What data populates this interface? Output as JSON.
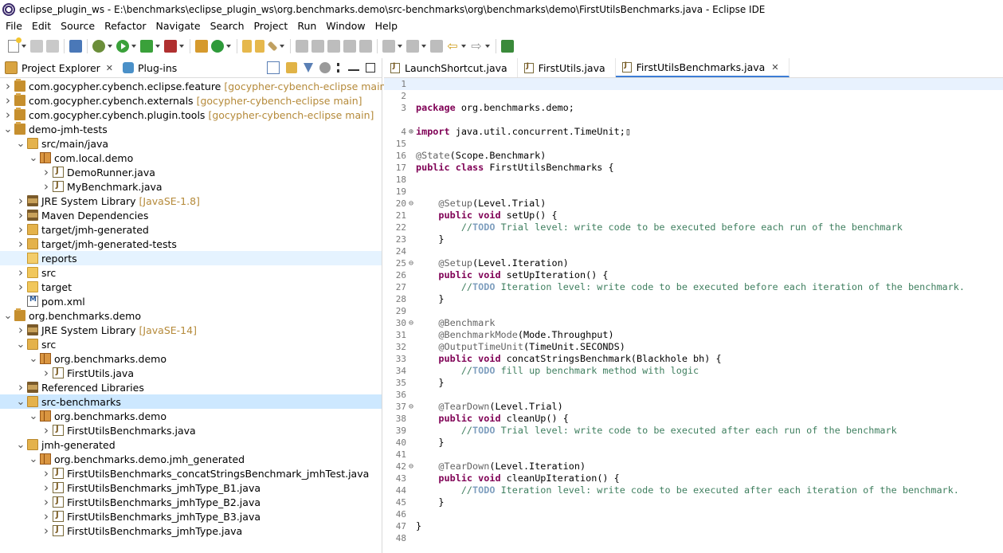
{
  "window": {
    "title": "eclipse_plugin_ws - E:\\benchmarks\\eclipse_plugin_ws\\org.benchmarks.demo\\src-benchmarks\\org\\benchmarks\\demo\\FirstUtilsBenchmarks.java - Eclipse IDE"
  },
  "menu": [
    "File",
    "Edit",
    "Source",
    "Refactor",
    "Navigate",
    "Search",
    "Project",
    "Run",
    "Window",
    "Help"
  ],
  "left_tabs": [
    {
      "label": "Project Explorer",
      "active": true,
      "closable": true
    },
    {
      "label": "Plug-ins",
      "active": false,
      "closable": false
    }
  ],
  "tree": [
    {
      "indent": 0,
      "twisty": ">",
      "icon": "project",
      "label": "com.gocypher.cybench.eclipse.feature",
      "decor": "[gocypher-cybench-eclipse main]"
    },
    {
      "indent": 0,
      "twisty": ">",
      "icon": "project",
      "label": "com.gocypher.cybench.externals",
      "decor": "[gocypher-cybench-eclipse main]"
    },
    {
      "indent": 0,
      "twisty": ">",
      "icon": "project",
      "label": "com.gocypher.cybench.plugin.tools",
      "decor": "[gocypher-cybench-eclipse main]"
    },
    {
      "indent": 0,
      "twisty": "v",
      "icon": "project",
      "label": "demo-jmh-tests",
      "decor": ""
    },
    {
      "indent": 1,
      "twisty": "v",
      "icon": "srcfolder",
      "label": "src/main/java",
      "decor": ""
    },
    {
      "indent": 2,
      "twisty": "v",
      "icon": "package",
      "label": "com.local.demo",
      "decor": ""
    },
    {
      "indent": 3,
      "twisty": ">",
      "icon": "java",
      "label": "DemoRunner.java",
      "decor": ""
    },
    {
      "indent": 3,
      "twisty": ">",
      "icon": "java",
      "label": "MyBenchmark.java",
      "decor": ""
    },
    {
      "indent": 1,
      "twisty": ">",
      "icon": "library",
      "label": "JRE System Library",
      "decor": "[JavaSE-1.8]"
    },
    {
      "indent": 1,
      "twisty": ">",
      "icon": "library",
      "label": "Maven Dependencies",
      "decor": ""
    },
    {
      "indent": 1,
      "twisty": ">",
      "icon": "srcfolder",
      "label": "target/jmh-generated",
      "decor": ""
    },
    {
      "indent": 1,
      "twisty": ">",
      "icon": "srcfolder",
      "label": "target/jmh-generated-tests",
      "decor": ""
    },
    {
      "indent": 1,
      "twisty": "",
      "icon": "reports",
      "label": "reports",
      "decor": "",
      "highlighted": true
    },
    {
      "indent": 1,
      "twisty": ">",
      "icon": "folder",
      "label": "src",
      "decor": ""
    },
    {
      "indent": 1,
      "twisty": ">",
      "icon": "folder",
      "label": "target",
      "decor": ""
    },
    {
      "indent": 1,
      "twisty": "",
      "icon": "xml",
      "label": "pom.xml",
      "decor": ""
    },
    {
      "indent": 0,
      "twisty": "v",
      "icon": "project",
      "label": "org.benchmarks.demo",
      "decor": ""
    },
    {
      "indent": 1,
      "twisty": ">",
      "icon": "library",
      "label": "JRE System Library",
      "decor": "[JavaSE-14]"
    },
    {
      "indent": 1,
      "twisty": "v",
      "icon": "srcfolder",
      "label": "src",
      "decor": ""
    },
    {
      "indent": 2,
      "twisty": "v",
      "icon": "package",
      "label": "org.benchmarks.demo",
      "decor": ""
    },
    {
      "indent": 3,
      "twisty": ">",
      "icon": "java",
      "label": "FirstUtils.java",
      "decor": ""
    },
    {
      "indent": 1,
      "twisty": ">",
      "icon": "library",
      "label": "Referenced Libraries",
      "decor": ""
    },
    {
      "indent": 1,
      "twisty": "v",
      "icon": "srcfolder",
      "label": "src-benchmarks",
      "decor": "",
      "selected": true
    },
    {
      "indent": 2,
      "twisty": "v",
      "icon": "package",
      "label": "org.benchmarks.demo",
      "decor": ""
    },
    {
      "indent": 3,
      "twisty": ">",
      "icon": "java",
      "label": "FirstUtilsBenchmarks.java",
      "decor": ""
    },
    {
      "indent": 1,
      "twisty": "v",
      "icon": "srcfolder",
      "label": "jmh-generated",
      "decor": ""
    },
    {
      "indent": 2,
      "twisty": "v",
      "icon": "package",
      "label": "org.benchmarks.demo.jmh_generated",
      "decor": ""
    },
    {
      "indent": 3,
      "twisty": ">",
      "icon": "java",
      "label": "FirstUtilsBenchmarks_concatStringsBenchmark_jmhTest.java",
      "decor": ""
    },
    {
      "indent": 3,
      "twisty": ">",
      "icon": "java",
      "label": "FirstUtilsBenchmarks_jmhType_B1.java",
      "decor": ""
    },
    {
      "indent": 3,
      "twisty": ">",
      "icon": "java",
      "label": "FirstUtilsBenchmarks_jmhType_B2.java",
      "decor": ""
    },
    {
      "indent": 3,
      "twisty": ">",
      "icon": "java",
      "label": "FirstUtilsBenchmarks_jmhType_B3.java",
      "decor": ""
    },
    {
      "indent": 3,
      "twisty": ">",
      "icon": "java",
      "label": "FirstUtilsBenchmarks_jmhType.java",
      "decor": ""
    }
  ],
  "editor_tabs": [
    {
      "label": "LaunchShortcut.java",
      "active": false
    },
    {
      "label": "FirstUtils.java",
      "active": false
    },
    {
      "label": "FirstUtilsBenchmarks.java",
      "active": true
    }
  ],
  "code": [
    {
      "n": "1",
      "fold": "",
      "current": true,
      "parts": []
    },
    {
      "n": "2",
      "fold": "",
      "parts": []
    },
    {
      "n": "3",
      "fold": "",
      "parts": [
        [
          "kw",
          "package"
        ],
        [
          "t",
          " org.benchmarks.demo;"
        ]
      ]
    },
    {
      "n": "",
      "fold": "",
      "parts": []
    },
    {
      "n": "4",
      "fold": "+",
      "parts": [
        [
          "kw",
          "import"
        ],
        [
          "t",
          " java.util.concurrent.TimeUnit;"
        ],
        [
          "t",
          "▯"
        ]
      ]
    },
    {
      "n": "15",
      "fold": "",
      "parts": []
    },
    {
      "n": "16",
      "fold": "",
      "parts": [
        [
          "ann",
          "@State"
        ],
        [
          "t",
          "(Scope.Benchmark)"
        ]
      ]
    },
    {
      "n": "17",
      "fold": "",
      "parts": [
        [
          "kw",
          "public"
        ],
        [
          "t",
          " "
        ],
        [
          "kw",
          "class"
        ],
        [
          "t",
          " FirstUtilsBenchmarks {"
        ]
      ]
    },
    {
      "n": "18",
      "fold": "",
      "parts": []
    },
    {
      "n": "19",
      "fold": "",
      "parts": []
    },
    {
      "n": "20",
      "fold": "-",
      "parts": [
        [
          "t",
          "    "
        ],
        [
          "ann",
          "@Setup"
        ],
        [
          "t",
          "(Level.Trial)"
        ]
      ]
    },
    {
      "n": "21",
      "fold": "",
      "parts": [
        [
          "t",
          "    "
        ],
        [
          "kw",
          "public"
        ],
        [
          "t",
          " "
        ],
        [
          "kw",
          "void"
        ],
        [
          "t",
          " setUp() {"
        ]
      ]
    },
    {
      "n": "22",
      "fold": "",
      "parts": [
        [
          "t",
          "        "
        ],
        [
          "cmt",
          "//"
        ],
        [
          "todo",
          "TODO"
        ],
        [
          "cmt",
          " Trial level: write code to be executed before each run of the benchmark"
        ]
      ]
    },
    {
      "n": "23",
      "fold": "",
      "parts": [
        [
          "t",
          "    }"
        ]
      ]
    },
    {
      "n": "24",
      "fold": "",
      "parts": []
    },
    {
      "n": "25",
      "fold": "-",
      "parts": [
        [
          "t",
          "    "
        ],
        [
          "ann",
          "@Setup"
        ],
        [
          "t",
          "(Level.Iteration)"
        ]
      ]
    },
    {
      "n": "26",
      "fold": "",
      "parts": [
        [
          "t",
          "    "
        ],
        [
          "kw",
          "public"
        ],
        [
          "t",
          " "
        ],
        [
          "kw",
          "void"
        ],
        [
          "t",
          " setUpIteration() {"
        ]
      ]
    },
    {
      "n": "27",
      "fold": "",
      "parts": [
        [
          "t",
          "        "
        ],
        [
          "cmt",
          "//"
        ],
        [
          "todo",
          "TODO"
        ],
        [
          "cmt",
          " Iteration level: write code to be executed before each iteration of the benchmark."
        ]
      ]
    },
    {
      "n": "28",
      "fold": "",
      "parts": [
        [
          "t",
          "    }"
        ]
      ]
    },
    {
      "n": "29",
      "fold": "",
      "parts": []
    },
    {
      "n": "30",
      "fold": "-",
      "parts": [
        [
          "t",
          "    "
        ],
        [
          "ann",
          "@Benchmark"
        ]
      ]
    },
    {
      "n": "31",
      "fold": "",
      "parts": [
        [
          "t",
          "    "
        ],
        [
          "ann",
          "@BenchmarkMode"
        ],
        [
          "t",
          "(Mode.Throughput)"
        ]
      ]
    },
    {
      "n": "32",
      "fold": "",
      "parts": [
        [
          "t",
          "    "
        ],
        [
          "ann",
          "@OutputTimeUnit"
        ],
        [
          "t",
          "(TimeUnit.SECONDS)"
        ]
      ]
    },
    {
      "n": "33",
      "fold": "",
      "parts": [
        [
          "t",
          "    "
        ],
        [
          "kw",
          "public"
        ],
        [
          "t",
          " "
        ],
        [
          "kw",
          "void"
        ],
        [
          "t",
          " concatStringsBenchmark(Blackhole bh) {"
        ]
      ]
    },
    {
      "n": "34",
      "fold": "",
      "parts": [
        [
          "t",
          "        "
        ],
        [
          "cmt",
          "//"
        ],
        [
          "todo",
          "TODO"
        ],
        [
          "cmt",
          " fill up benchmark method with logic"
        ]
      ]
    },
    {
      "n": "35",
      "fold": "",
      "parts": [
        [
          "t",
          "    }"
        ]
      ]
    },
    {
      "n": "36",
      "fold": "",
      "parts": []
    },
    {
      "n": "37",
      "fold": "-",
      "parts": [
        [
          "t",
          "    "
        ],
        [
          "ann",
          "@TearDown"
        ],
        [
          "t",
          "(Level.Trial)"
        ]
      ]
    },
    {
      "n": "38",
      "fold": "",
      "parts": [
        [
          "t",
          "    "
        ],
        [
          "kw",
          "public"
        ],
        [
          "t",
          " "
        ],
        [
          "kw",
          "void"
        ],
        [
          "t",
          " cleanUp() {"
        ]
      ]
    },
    {
      "n": "39",
      "fold": "",
      "parts": [
        [
          "t",
          "        "
        ],
        [
          "cmt",
          "//"
        ],
        [
          "todo",
          "TODO"
        ],
        [
          "cmt",
          " Trial level: write code to be executed after each run of the benchmark"
        ]
      ]
    },
    {
      "n": "40",
      "fold": "",
      "parts": [
        [
          "t",
          "    }"
        ]
      ]
    },
    {
      "n": "41",
      "fold": "",
      "parts": []
    },
    {
      "n": "42",
      "fold": "-",
      "parts": [
        [
          "t",
          "    "
        ],
        [
          "ann",
          "@TearDown"
        ],
        [
          "t",
          "(Level.Iteration)"
        ]
      ]
    },
    {
      "n": "43",
      "fold": "",
      "parts": [
        [
          "t",
          "    "
        ],
        [
          "kw",
          "public"
        ],
        [
          "t",
          " "
        ],
        [
          "kw",
          "void"
        ],
        [
          "t",
          " cleanUpIteration() {"
        ]
      ]
    },
    {
      "n": "44",
      "fold": "",
      "parts": [
        [
          "t",
          "        "
        ],
        [
          "cmt",
          "//"
        ],
        [
          "todo",
          "TODO"
        ],
        [
          "cmt",
          " Iteration level: write code to be executed after each iteration of the benchmark."
        ]
      ]
    },
    {
      "n": "45",
      "fold": "",
      "parts": [
        [
          "t",
          "    }"
        ]
      ]
    },
    {
      "n": "46",
      "fold": "",
      "parts": []
    },
    {
      "n": "47",
      "fold": "",
      "parts": [
        [
          "t",
          "}"
        ]
      ]
    },
    {
      "n": "48",
      "fold": "",
      "parts": []
    }
  ]
}
